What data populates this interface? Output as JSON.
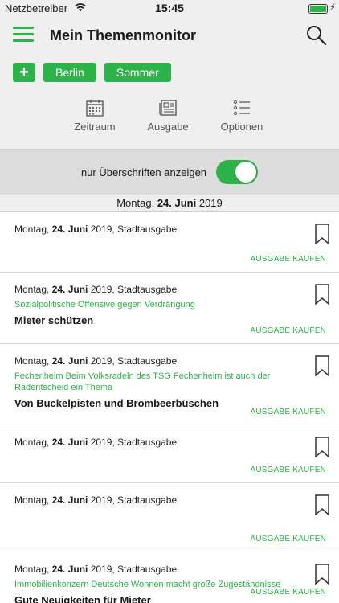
{
  "status": {
    "carrier": "Netzbetreiber",
    "time": "15:45"
  },
  "nav": {
    "title": "Mein Themenmonitor"
  },
  "chips": {
    "add": "+",
    "items": [
      "Berlin",
      "Sommer"
    ]
  },
  "tools": [
    {
      "label": "Zeitraum",
      "icon": "calendar-icon"
    },
    {
      "label": "Ausgabe",
      "icon": "newspaper-icon"
    },
    {
      "label": "Optionen",
      "icon": "list-icon"
    }
  ],
  "toggle": {
    "label": "nur Überschriften anzeigen",
    "on": true
  },
  "date_header": {
    "prefix": "Montag, ",
    "bold": "24. Juni",
    "suffix": " 2019"
  },
  "articles": [
    {
      "weekday": "Montag, ",
      "date": "24. Juni",
      "rest": " 2019,  Stadtausgabe",
      "kicker": "",
      "headline": "",
      "buy": "AUSGABE KAUFEN"
    },
    {
      "weekday": "Montag, ",
      "date": "24. Juni",
      "rest": " 2019,  Stadtausgabe",
      "kicker": "Sozialpolitische Offensive gegen Verdrängung",
      "headline": "Mieter schützen",
      "buy": "AUSGABE KAUFEN"
    },
    {
      "weekday": "Montag, ",
      "date": "24. Juni",
      "rest": " 2019,  Stadtausgabe",
      "kicker": "Fechenheim Beim Volksradeln des TSG Fechenheim ist auch der Radentscheid ein Thema",
      "headline": "Von Buckelpisten und Brombeerbüschen",
      "buy": "AUSGABE KAUFEN"
    },
    {
      "weekday": "Montag, ",
      "date": "24. Juni",
      "rest": " 2019,  Stadtausgabe",
      "kicker": "",
      "headline": "",
      "buy": "AUSGABE KAUFEN"
    },
    {
      "weekday": "Montag, ",
      "date": "24. Juni",
      "rest": " 2019,  Stadtausgabe",
      "kicker": "",
      "headline": "",
      "buy": "AUSGABE KAUFEN"
    },
    {
      "weekday": "Montag, ",
      "date": "24. Juni",
      "rest": " 2019,  Stadtausgabe",
      "kicker": "Immobilienkonzern Deutsche Wohnen macht  große Zugeständnisse",
      "headline": "Gute Neuigkeiten für Mieter",
      "buy": "AUSGABE KAUFEN"
    }
  ],
  "colors": {
    "accent": "#2db34a",
    "bar": "#efefef",
    "toggle_bar": "#dcdcdc"
  }
}
